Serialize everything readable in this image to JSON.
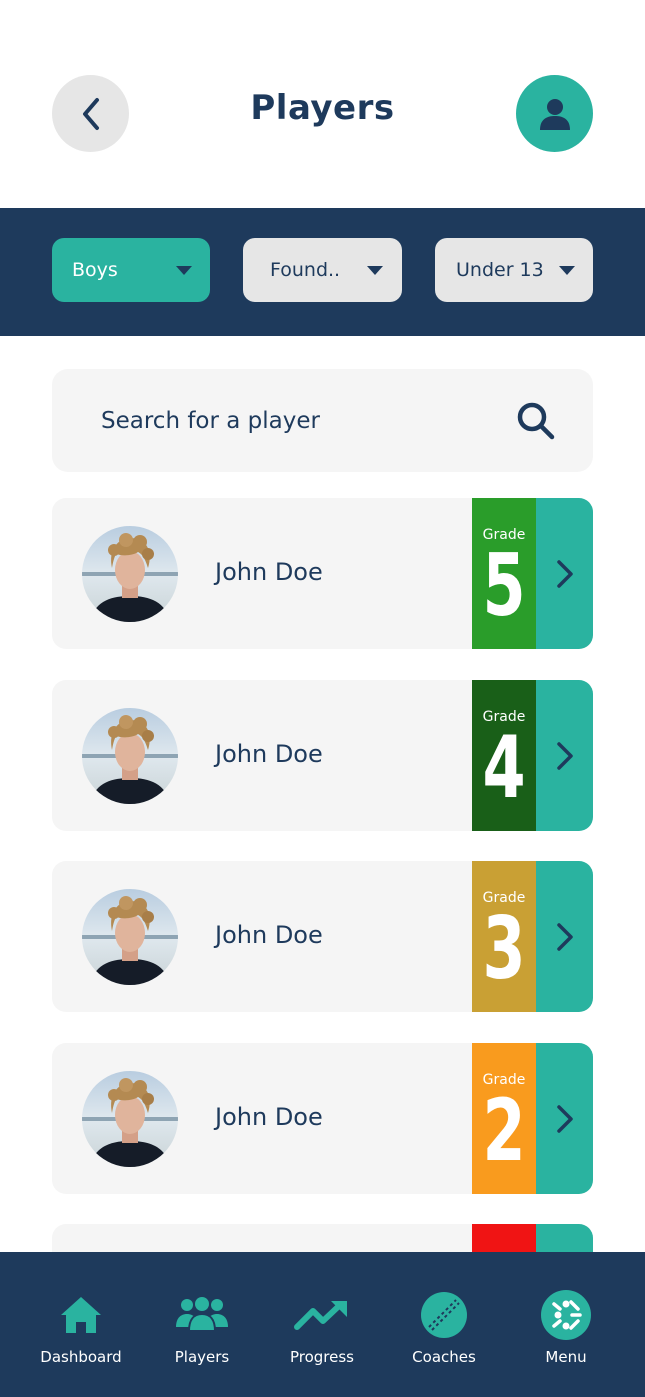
{
  "header": {
    "title": "Players"
  },
  "filters": [
    {
      "label": "Boys"
    },
    {
      "label": "Found.."
    },
    {
      "label": "Under 13"
    }
  ],
  "search": {
    "placeholder": "Search for a player"
  },
  "players": [
    {
      "name": "John Doe",
      "grade_label": "Grade",
      "grade": "5",
      "grade_color": "#2a9d2a"
    },
    {
      "name": "John Doe",
      "grade_label": "Grade",
      "grade": "4",
      "grade_color": "#195f18"
    },
    {
      "name": "John Doe",
      "grade_label": "Grade",
      "grade": "3",
      "grade_color": "#c9a034"
    },
    {
      "name": "John Doe",
      "grade_label": "Grade",
      "grade": "2",
      "grade_color": "#f99b1e"
    },
    {
      "name": "",
      "grade_label": "",
      "grade": "",
      "grade_color": "#f01414"
    }
  ],
  "nav": [
    {
      "label": "Dashboard",
      "icon": "home-icon"
    },
    {
      "label": "Players",
      "icon": "group-icon"
    },
    {
      "label": "Progress",
      "icon": "trend-up-icon"
    },
    {
      "label": "Coaches",
      "icon": "cricket-ball-icon"
    },
    {
      "label": "Menu",
      "icon": "menu-logo-icon"
    }
  ],
  "colors": {
    "navy": "#1e3a5c",
    "teal": "#2ab3a0"
  }
}
